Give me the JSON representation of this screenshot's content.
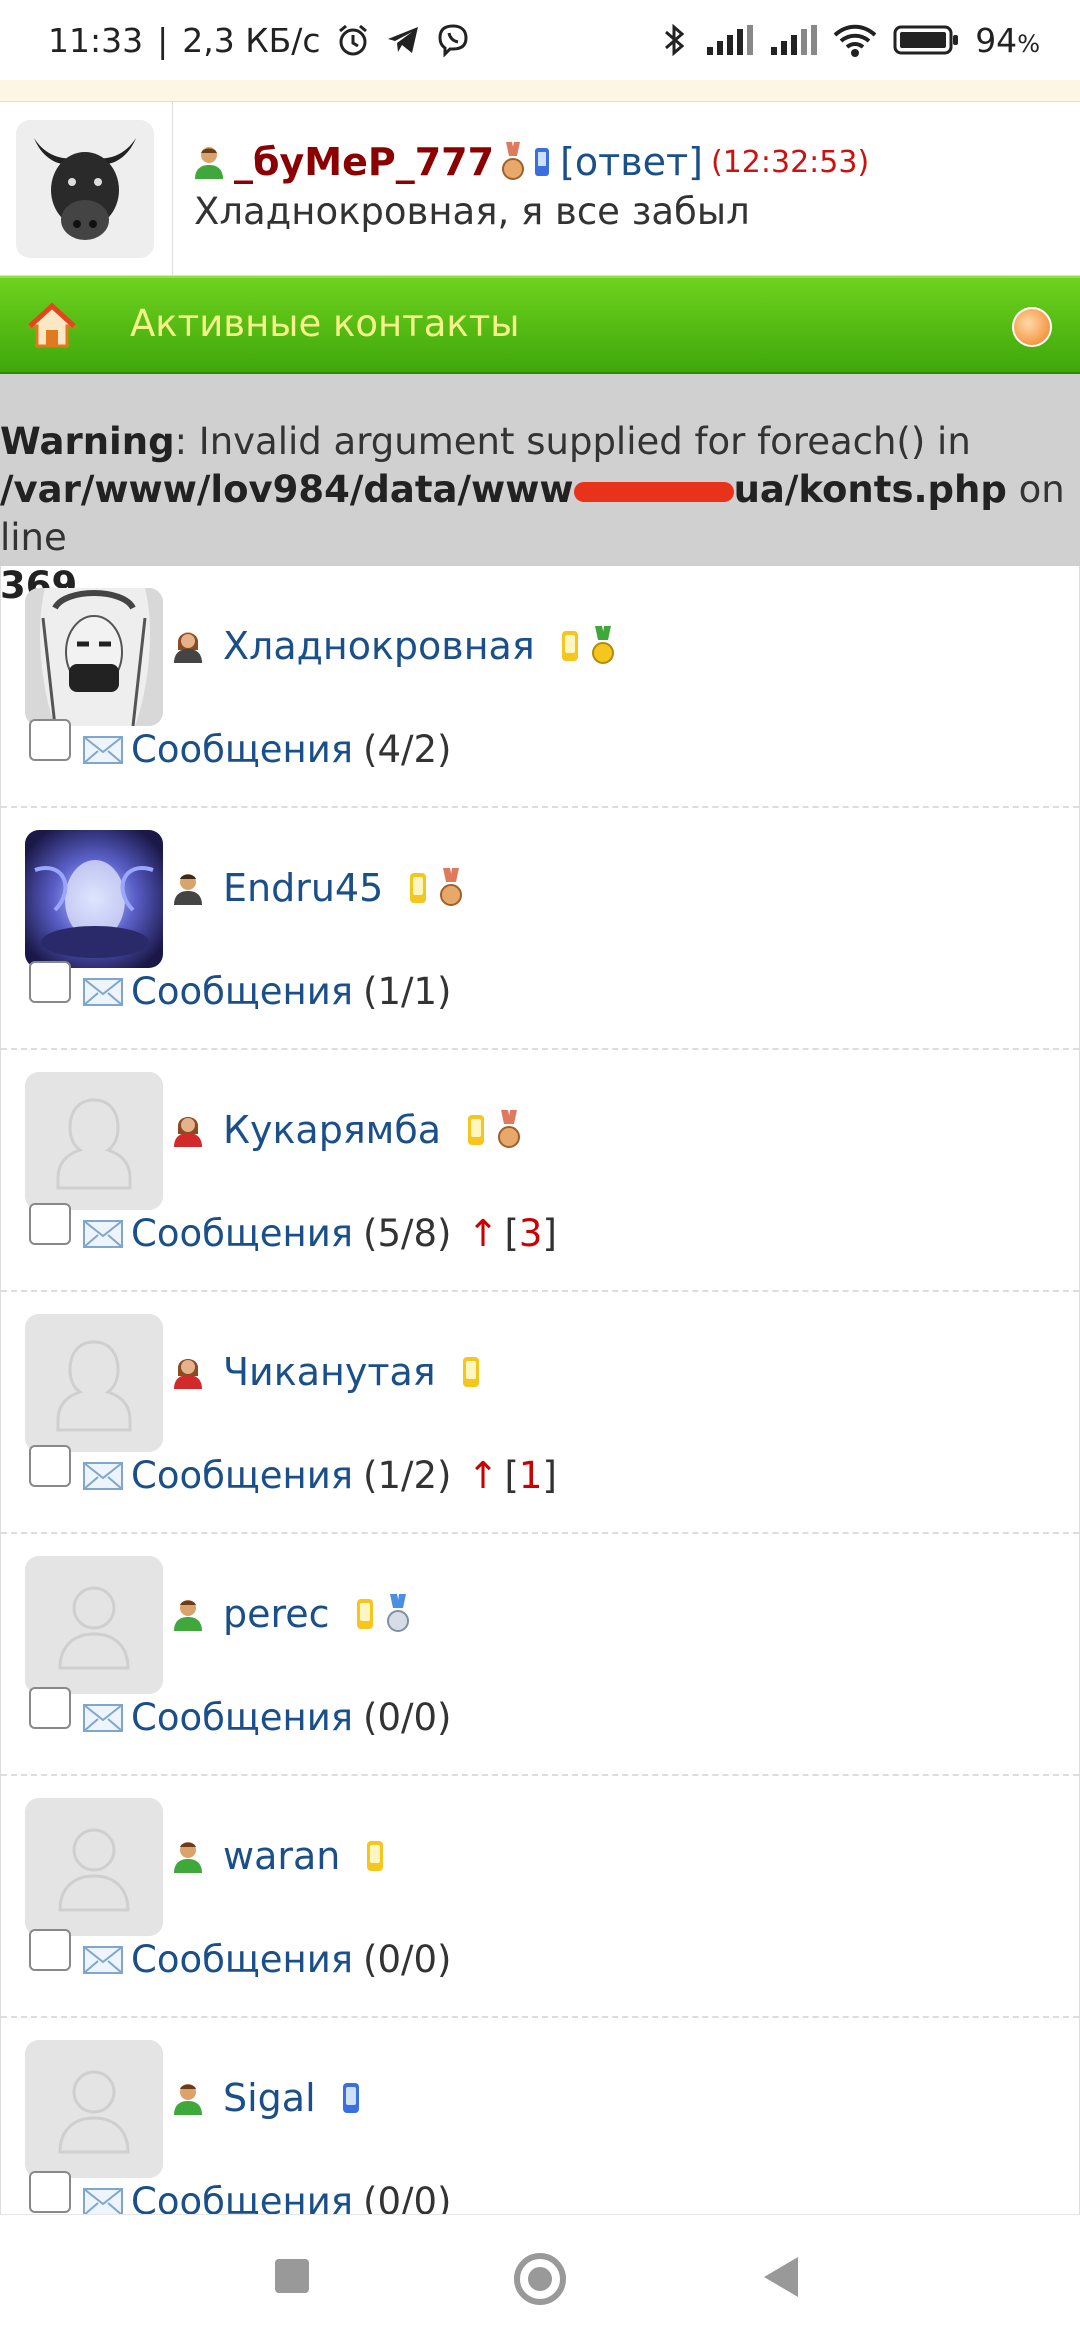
{
  "status_bar": {
    "time": "11:33",
    "speed": "2,3 КБ/с",
    "battery": "94",
    "battery_unit": "%"
  },
  "notification": {
    "sender": "_бyMeP_777",
    "reply_label": "[ответ]",
    "time": "(12:32:53)",
    "message": "Хладнокровная, я все забыл"
  },
  "header": {
    "title": "Активные контакты"
  },
  "warning": {
    "label": "Warning",
    "text": ": Invalid argument supplied for foreach() in",
    "path_start": "/var/www/lov984/data/www",
    "path_end": "ua/konts.php",
    "line_text": " on line",
    "line_number": "369"
  },
  "messages_label": "Сообщения",
  "contacts": [
    {
      "name": "Хладнокровная",
      "counts": "(4/2)",
      "new": "",
      "gender": "female",
      "phone": "yellow",
      "medal": "green",
      "avatar": "photo-girl"
    },
    {
      "name": "Endru45",
      "counts": "(1/1)",
      "new": "",
      "gender": "male",
      "phone": "yellow",
      "medal": "bronze",
      "avatar": "photo-fantasy"
    },
    {
      "name": "Кукарямба",
      "counts": "(5/8)",
      "arrow": "↑",
      "new": "3",
      "gender": "female-red",
      "phone": "yellow",
      "medal": "bronze",
      "avatar": "placeholder-female"
    },
    {
      "name": "Чиканутая",
      "counts": "(1/2)",
      "arrow": "↑",
      "new": "1",
      "gender": "female-red",
      "phone": "yellow",
      "medal": "",
      "avatar": "placeholder-female"
    },
    {
      "name": "perec",
      "counts": "(0/0)",
      "new": "",
      "gender": "male-green",
      "phone": "yellow",
      "medal": "blue",
      "avatar": "placeholder-male"
    },
    {
      "name": "waran",
      "counts": "(0/0)",
      "new": "",
      "gender": "male-green",
      "phone": "yellow",
      "medal": "",
      "avatar": "placeholder-male"
    },
    {
      "name": "Sigal",
      "counts": "(0/0)",
      "new": "",
      "gender": "male-green",
      "phone": "blue",
      "medal": "",
      "avatar": "placeholder-male"
    }
  ]
}
